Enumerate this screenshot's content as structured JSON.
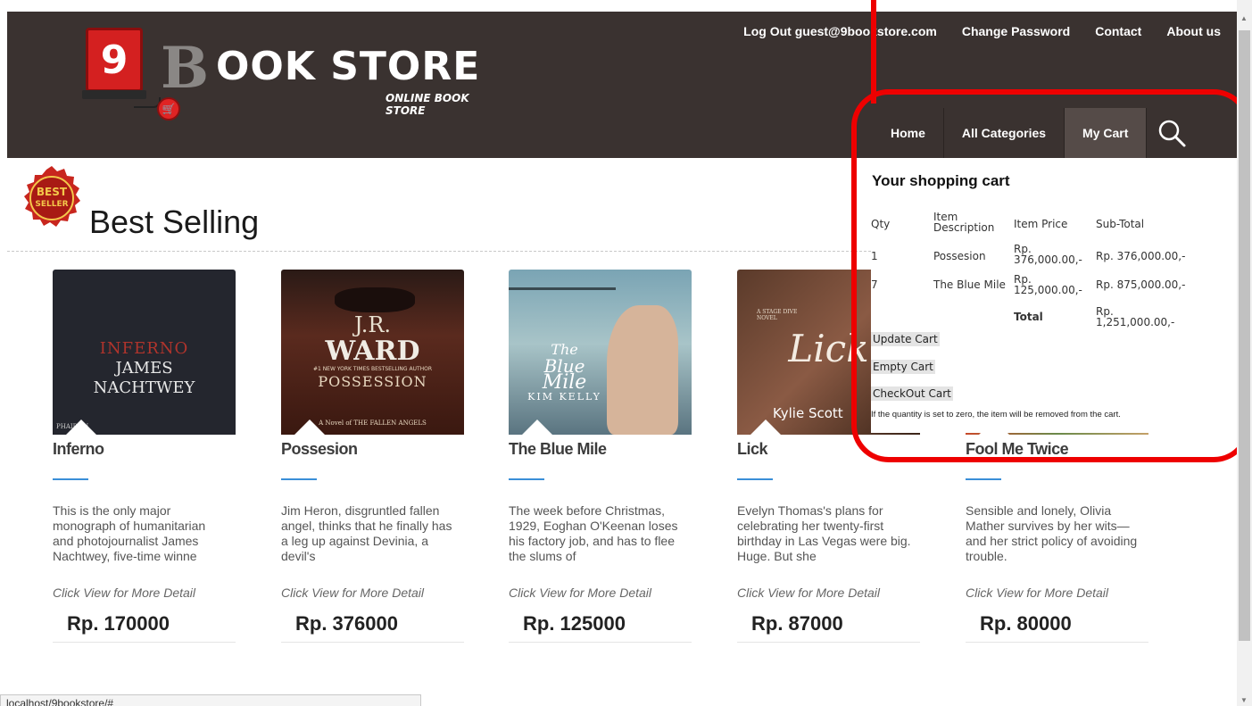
{
  "header": {
    "logo_number": "9",
    "logo_b": "B",
    "logo_rest": "OOK STORE",
    "logo_tagline": "ONLINE BOOK STORE",
    "top_links": [
      "Log Out guest@9bookstore.com",
      "Change Password",
      "Contact",
      "About us"
    ],
    "nav": [
      "Home",
      "All Categories",
      "My Cart"
    ],
    "nav_active": "My Cart",
    "search_icon": "search-icon"
  },
  "section": {
    "badge_line1": "BEST",
    "badge_line2": "SELLER",
    "title": "Best Selling"
  },
  "books": [
    {
      "cover_lines": [
        "INFERNO",
        "JAMES",
        "NACHTWEY"
      ],
      "cover_footer": "PHAIDON",
      "title": "Inferno",
      "description": "This is the only major monograph of humanitarian and photojournalist James Nachtwey, five-time winne",
      "detail": "Click View for More Detail",
      "price": "Rp. 170000"
    },
    {
      "cover_lines": [
        "J.R.",
        "WARD",
        "POSSESSION"
      ],
      "cover_footer": "A Novel of THE FALLEN ANGELS",
      "cover_tagline": "#1 NEW YORK TIMES BESTSELLING AUTHOR",
      "title": "Possesion",
      "description": "Jim Heron, disgruntled fallen angel, thinks that he finally has a leg up against Devinia, a devil's",
      "detail": "Click View for More Detail",
      "price": "Rp. 376000"
    },
    {
      "cover_lines": [
        "The",
        "Blue",
        "Mile",
        "KIM KELLY"
      ],
      "title": "The Blue Mile",
      "description": "The week before Christmas, 1929, Eoghan O'Keenan loses his factory job, and has to flee the slums of",
      "detail": "Click View for More Detail",
      "price": "Rp. 125000"
    },
    {
      "cover_lines": [
        "Lick",
        "Kylie Scott"
      ],
      "cover_tagline": "A STAGE DIVE NOVEL",
      "title": "Lick",
      "description": "Evelyn Thomas's plans for celebrating her twenty-first birthday in Las Vegas were big. Huge. But she",
      "detail": "Click View for More Detail",
      "price": "Rp. 87000"
    },
    {
      "title": "Fool Me Twice",
      "description": "Sensible and lonely, Olivia Mather survives by her wits—and her strict policy of avoiding trouble.",
      "detail": "Click View for More Detail",
      "price": "Rp. 80000"
    }
  ],
  "cart": {
    "title": "Your shopping cart",
    "headers": {
      "qty": "Qty",
      "desc": "Item Description",
      "price": "Item Price",
      "subtotal": "Sub-Total"
    },
    "rows": [
      {
        "qty": "1",
        "desc": "Possesion",
        "price": "Rp. 376,000.00,-",
        "subtotal": "Rp. 376,000.00,-"
      },
      {
        "qty": "7",
        "desc": "The Blue Mile",
        "price": "Rp. 125,000.00,-",
        "subtotal": "Rp. 875,000.00,-"
      }
    ],
    "total_label": "Total",
    "total_value": "Rp. 1,251,000.00,-",
    "buttons": {
      "update": "Update Cart",
      "empty": "Empty Cart",
      "checkout": "CheckOut Cart"
    },
    "note": "If the quantity is set to zero, the item will be removed from the cart."
  },
  "status_url": "localhost/9bookstore/#",
  "colors": {
    "header_bg": "#3a3230",
    "annotation": "#ee0000",
    "accent_rule": "#3a8fd8"
  }
}
